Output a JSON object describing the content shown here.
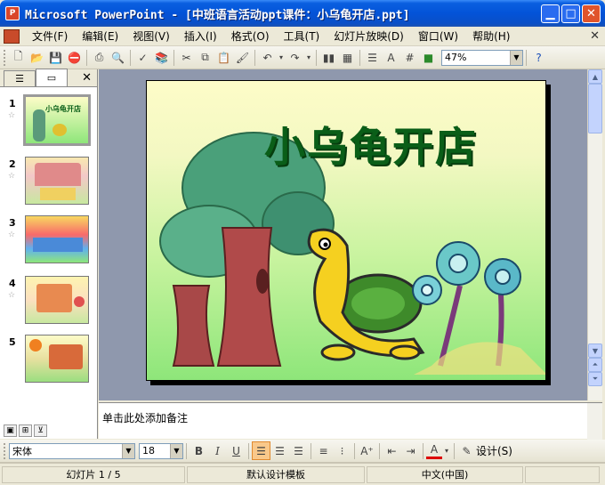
{
  "window": {
    "title": "Microsoft PowerPoint - [中班语言活动ppt课件：小乌龟开店.ppt]",
    "app_icon": "powerpoint-icon",
    "buttons": [
      "minimize",
      "maximize",
      "close"
    ]
  },
  "menu": {
    "items": [
      "文件(F)",
      "编辑(E)",
      "视图(V)",
      "插入(I)",
      "格式(O)",
      "工具(T)",
      "幻灯片放映(D)",
      "窗口(W)",
      "帮助(H)"
    ]
  },
  "standard_toolbar": {
    "zoom": "47%"
  },
  "formatting_toolbar": {
    "font": "宋体",
    "size": "18",
    "bold": "B",
    "italic": "I",
    "underline": "U",
    "design_button": "设计(S)"
  },
  "left_panel": {
    "slides": [
      {
        "num": "1",
        "selected": true,
        "thumb_title": "小乌龟开店"
      },
      {
        "num": "2",
        "selected": false
      },
      {
        "num": "3",
        "selected": false
      },
      {
        "num": "4",
        "selected": false
      },
      {
        "num": "5",
        "selected": false
      }
    ]
  },
  "slide": {
    "title": "小乌龟开店"
  },
  "notes": {
    "placeholder": "单击此处添加备注"
  },
  "status": {
    "slide_info": "幻灯片 1 / 5",
    "template": "默认设计模板",
    "language": "中文(中国)"
  },
  "colors": {
    "titlebar": "#0353d8",
    "slide_title": "#0a5e18",
    "workspace": "#8f98ad"
  }
}
